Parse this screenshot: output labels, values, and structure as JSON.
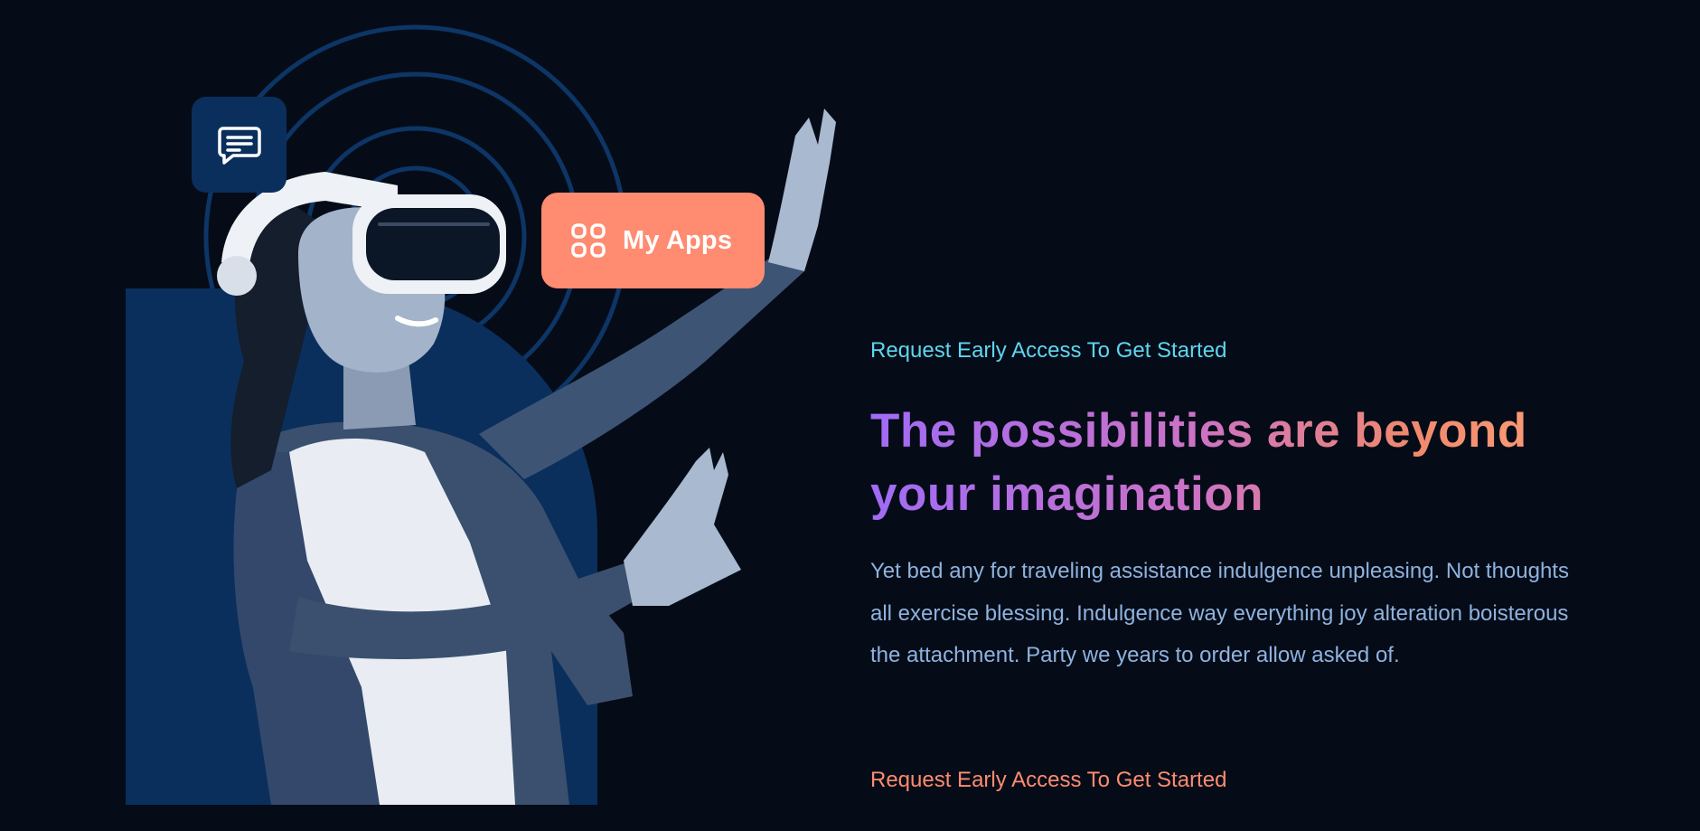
{
  "hero": {
    "eyebrow": "Request Early Access To Get Started",
    "headline": "The possibilities are beyond your imagination",
    "body": "Yet bed any for traveling assistance indulgence unpleasing. Not thoughts all exercise blessing. Indulgence way everything joy alteration boisterous the attachment. Party we years to order allow asked of.",
    "cta_label": "Request Early Access To Get Started"
  },
  "floating": {
    "chat_icon": "chat-bubble-icon",
    "apps_icon": "grid-apps-icon",
    "apps_label": "My Apps"
  },
  "colors": {
    "background": "#050c17",
    "panel": "#0a2f5c",
    "accent_coral": "#ff8b70",
    "accent_cyan": "#5fd6f0",
    "body_text": "#8fb2df",
    "headline_gradient": [
      "#a06bf6",
      "#cc72c6",
      "#f0896d",
      "#ffa178"
    ]
  }
}
